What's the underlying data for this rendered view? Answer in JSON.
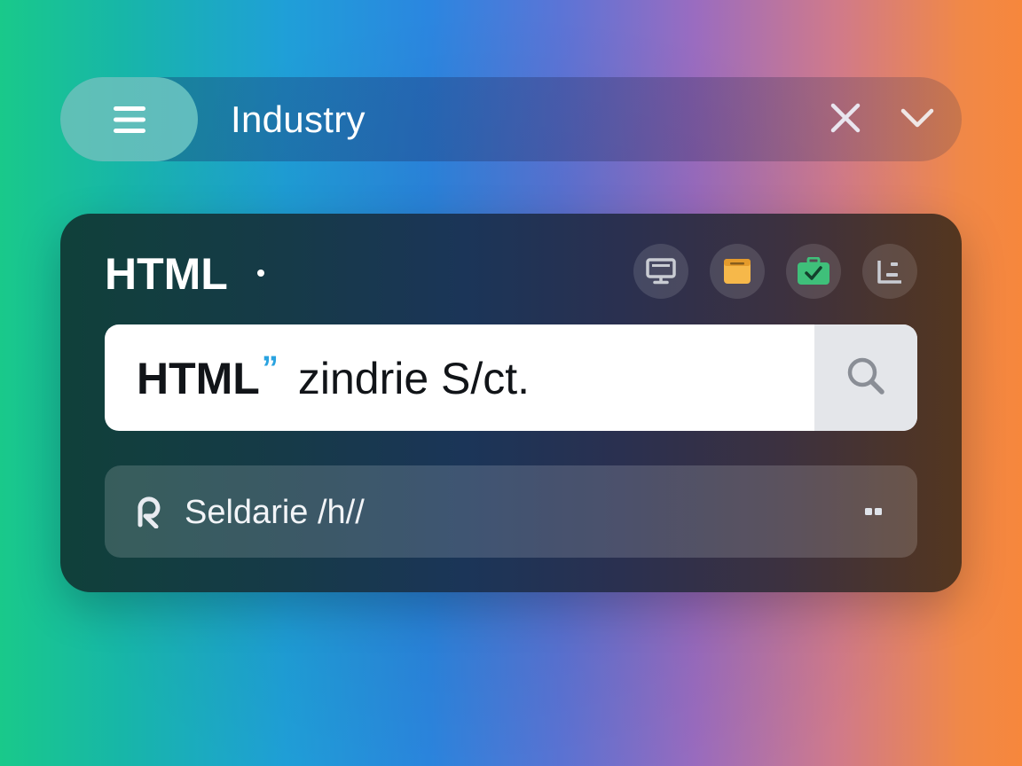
{
  "topbar": {
    "title": "Industry",
    "menu_icon": "hamburger-menu-icon",
    "clear_icon": "close-icon",
    "expand_icon": "chevron-down-icon"
  },
  "card": {
    "title": "HTML",
    "tools": [
      {
        "icon": "monitor-icon",
        "color": "#c9ccd3"
      },
      {
        "icon": "folder-icon",
        "color": "#f6b84a"
      },
      {
        "icon": "briefcase-check-icon",
        "color": "#3fc07a"
      },
      {
        "icon": "chart-corner-icon",
        "color": "#c9ccd3"
      }
    ],
    "search": {
      "value_strong": "HTML",
      "value_mark": "”",
      "value_rest": "zindrie S/ct.",
      "icon": "search-icon"
    },
    "suggestion": {
      "label": "Seldarie /h//",
      "icon": "tag-icon",
      "more_icon": "more-dots-icon"
    }
  },
  "colors": {
    "accent_blue": "#2aa3e0",
    "card_bg_start": "#10403a",
    "card_bg_end": "#54361f"
  }
}
